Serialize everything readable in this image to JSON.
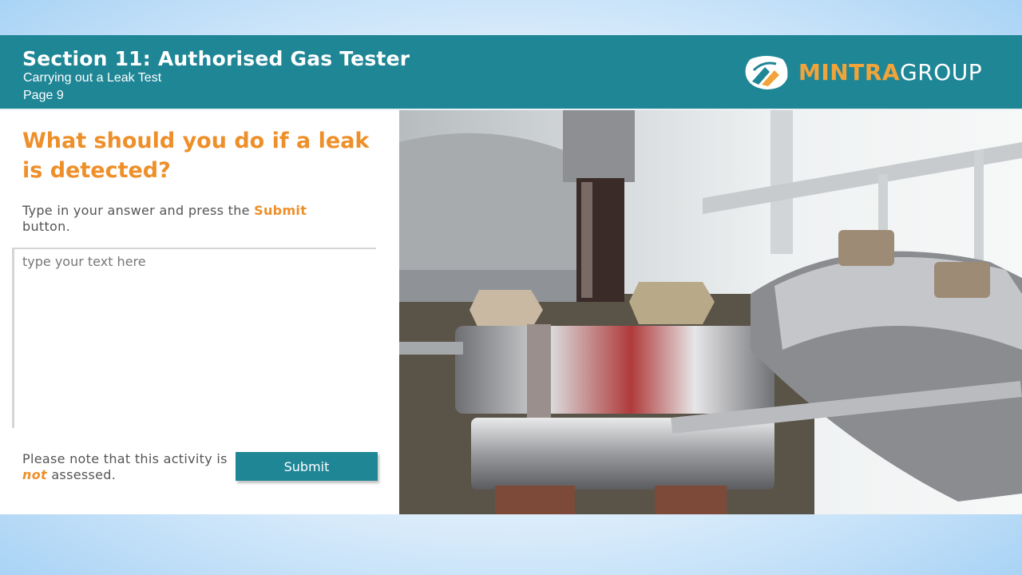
{
  "header": {
    "title": "Section 11: Authorised Gas Tester",
    "subtitle": "Carrying out a Leak Test",
    "page": "Page 9",
    "logo": {
      "part1": "MINTRA",
      "part2": "GROUP"
    }
  },
  "content": {
    "question": "What should you do if a leak is detected?",
    "instruction": {
      "before": "Type in your answer and press the ",
      "highlight": "Submit",
      "after": " button."
    },
    "answer_placeholder": "type your text here",
    "note": {
      "before": "Please note that this activity is ",
      "emphasis": "not",
      "after": " assessed."
    },
    "submit_label": "Submit"
  },
  "colors": {
    "header": "#1f8696",
    "accent": "#ee8f2a",
    "logo_accent": "#f2a33a",
    "text": "#555555"
  },
  "photo": {
    "subject": "industrial pipe flange with valve and bolts"
  }
}
